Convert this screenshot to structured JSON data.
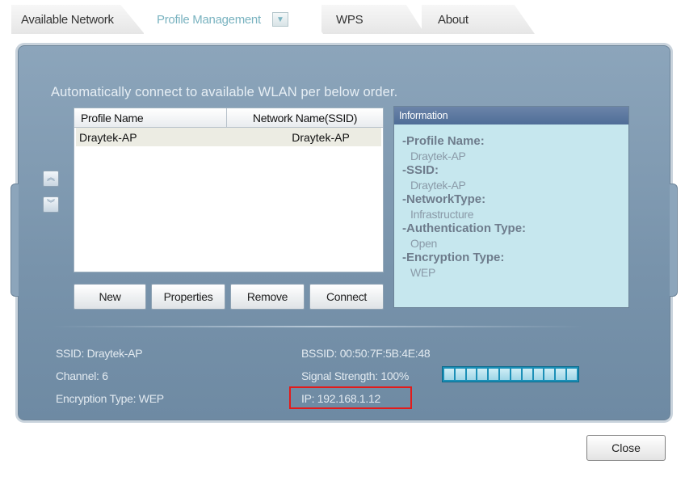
{
  "tabs": {
    "available_network": "Available Network",
    "profile_management": "Profile Management",
    "wps": "WPS",
    "about": "About"
  },
  "instruction": "Automatically connect to available WLAN per below order.",
  "profile_table": {
    "headers": [
      "Profile Name",
      "Network Name(SSID)"
    ],
    "rows": [
      {
        "profile_name": "Draytek-AP",
        "ssid": "Draytek-AP"
      }
    ]
  },
  "info": {
    "header": "Information",
    "profile_name_label": "-Profile Name:",
    "profile_name_value": "Draytek-AP",
    "ssid_label": "-SSID:",
    "ssid_value": "Draytek-AP",
    "network_type_label": "-NetworkType:",
    "network_type_value": "Infrastructure",
    "auth_type_label": "-Authentication Type:",
    "auth_type_value": "Open",
    "encryption_type_label": "-Encryption Type:",
    "encryption_type_value": "WEP"
  },
  "buttons": {
    "new": "New",
    "properties": "Properties",
    "remove": "Remove",
    "connect": "Connect",
    "close": "Close"
  },
  "status": {
    "ssid": "SSID: Draytek-AP",
    "channel": "Channel: 6",
    "encryption": "Encryption Type: WEP",
    "bssid": "BSSID: 00:50:7F:5B:4E:48",
    "signal_strength": "Signal Strength: 100%",
    "signal_level": 1.0,
    "ip": "IP: 192.168.1.12"
  },
  "icons": {
    "move_up": "double-chevron-up-icon",
    "move_down": "double-chevron-down-icon",
    "tab_dropdown": "dropdown-arrow-icon"
  },
  "colors": {
    "panel": "#7893ab",
    "info_bg": "#c6e7ee",
    "info_header": "#4f6d97",
    "signal_bar": "#1b8fb7",
    "highlight": "#e21b1b",
    "active_tab_text": "#7ab3c0"
  }
}
